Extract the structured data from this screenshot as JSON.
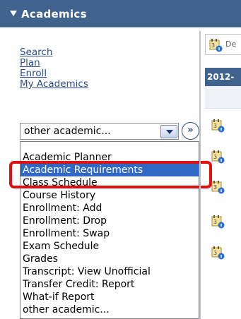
{
  "header": {
    "title": "Academics"
  },
  "nav": {
    "links": [
      "Search",
      "Plan",
      "Enroll",
      "My Academics"
    ]
  },
  "selector": {
    "value": "other academic...",
    "go_label": "»"
  },
  "dropdown": {
    "options": [
      "Academic Planner",
      "Academic Requirements",
      "Class Schedule",
      "Course History",
      "Enrollment: Add",
      "Enrollment: Drop",
      "Enrollment: Swap",
      "Exam Schedule",
      "Grades",
      "Transcript: View Unofficial",
      "Transfer Credit: Report",
      "What-if Report",
      "other academic..."
    ],
    "selected_index": 1,
    "highlight_color": "#3168c6",
    "annotation_color": "#e01010"
  },
  "right_panel": {
    "deadlines_label": "De",
    "term_label": "2012-",
    "row_icons": [
      "calendar-info-icon",
      "calendar-info-icon",
      "calendar-info-icon",
      "calendar-info-icon",
      "calendar-info-icon"
    ]
  },
  "colors": {
    "header_bg": "#3f638c",
    "link": "#2d4f8f"
  }
}
